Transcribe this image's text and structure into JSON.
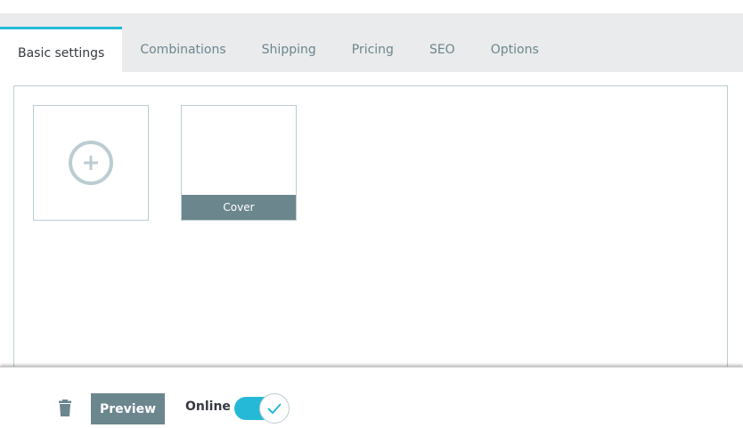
{
  "tabs": [
    {
      "label": "Basic settings",
      "active": true
    },
    {
      "label": "Combinations",
      "active": false
    },
    {
      "label": "Shipping",
      "active": false
    },
    {
      "label": "Pricing",
      "active": false
    },
    {
      "label": "SEO",
      "active": false
    },
    {
      "label": "Options",
      "active": false
    }
  ],
  "images": {
    "add_icon": "plus-circle-icon",
    "cover_label": "Cover"
  },
  "footer": {
    "delete_icon": "trash-icon",
    "preview_label": "Preview",
    "online_label": "Online",
    "online_enabled": true
  },
  "colors": {
    "accent": "#25b9d7",
    "muted": "#6c868e",
    "border": "#bbcdd2",
    "tab_bar_bg": "#eaebec"
  }
}
